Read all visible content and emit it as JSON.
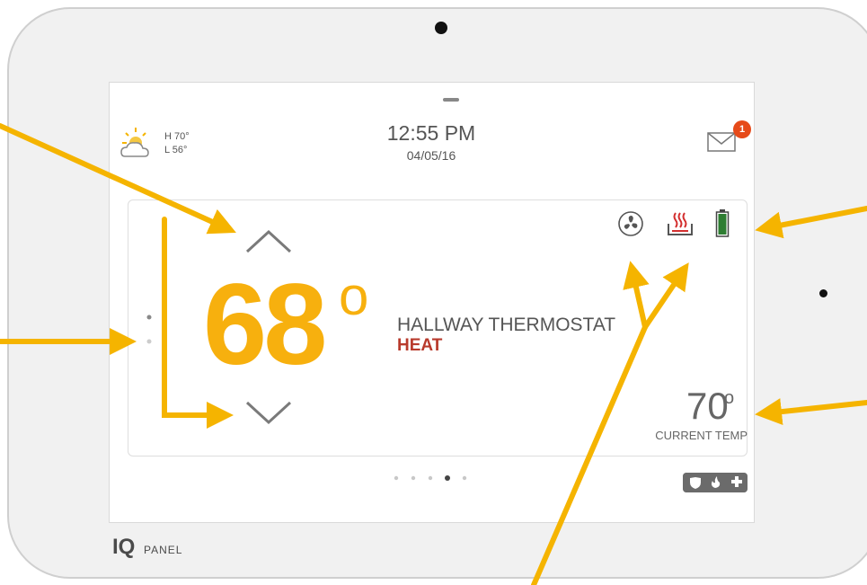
{
  "weather": {
    "icon": "partly-cloudy-icon",
    "high": "H 70°",
    "low": "L 56°"
  },
  "header": {
    "time": "12:55 PM",
    "date": "04/05/16"
  },
  "messages": {
    "icon": "mail-icon",
    "badge_count": "1"
  },
  "thermostat": {
    "setpoint": "68",
    "setpoint_unit": "o",
    "name": "HALLWAY THERMOSTAT",
    "mode": "HEAT",
    "current_temp": "70",
    "current_temp_unit": "o",
    "current_label": "CURRENT TEMP",
    "status_icons": [
      "fan-icon",
      "heat-icon",
      "battery-icon"
    ]
  },
  "pager": {
    "pages": 5,
    "active_index": 3
  },
  "brand": {
    "logo": "IQ",
    "sub": "PANEL"
  },
  "colors": {
    "accent": "#f7b00e",
    "heat": "#b83a2c",
    "battery": "#2e7d32",
    "badge": "#e64a19",
    "annotation": "#f5b400"
  }
}
